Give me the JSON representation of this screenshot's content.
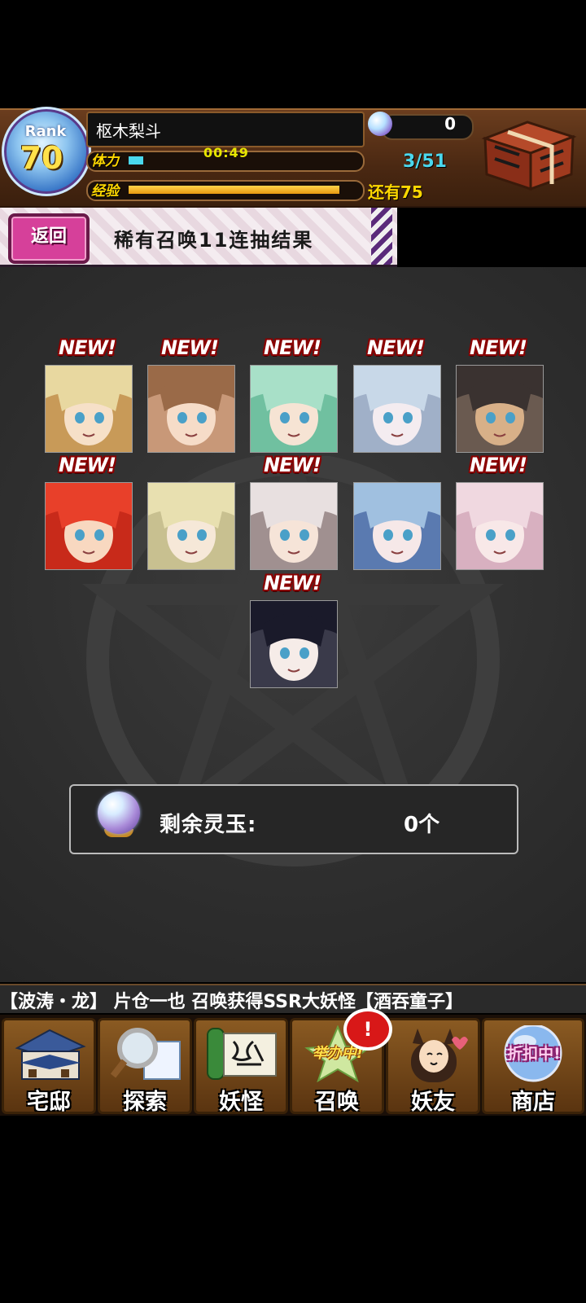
{
  "header": {
    "rank_word": "Rank",
    "rank_value": "70",
    "player_name": "枢木梨斗",
    "gem_count": "0",
    "stamina_label": "体力",
    "stamina_timer": "00:49",
    "stamina_count": "3/51",
    "stamina_fraction": 0.06,
    "exp_label": "经验",
    "exp_fraction": 0.92,
    "exp_remaining": "还有75"
  },
  "sub_header": {
    "back_label": "返回",
    "title": "稀有召唤11连抽结果"
  },
  "results": {
    "new_label": "NEW!",
    "cards": [
      {
        "is_new": true
      },
      {
        "is_new": true
      },
      {
        "is_new": true
      },
      {
        "is_new": true
      },
      {
        "is_new": true
      },
      {
        "is_new": true
      },
      {
        "is_new": false
      },
      {
        "is_new": true
      },
      {
        "is_new": false
      },
      {
        "is_new": true
      },
      {
        "is_new": true
      }
    ]
  },
  "orb_panel": {
    "label": "剩余灵玉:",
    "value": "0个"
  },
  "ticker": {
    "text": "【波涛・龙】 片仓一也 召唤获得SSR大妖怪【酒吞童子】"
  },
  "nav": {
    "items": [
      {
        "label": "宅邸",
        "icon": "mansion-icon"
      },
      {
        "label": "探索",
        "icon": "magnifier-map-icon"
      },
      {
        "label": "妖怪",
        "icon": "yokai-scroll-icon"
      },
      {
        "label": "召唤",
        "icon": "summon-star-icon",
        "tag": "举办中!"
      },
      {
        "label": "妖友",
        "icon": "fox-girl-icon"
      },
      {
        "label": "商店",
        "icon": "shop-orb-icon",
        "tag": "折扣中!"
      }
    ],
    "notification": "!"
  }
}
